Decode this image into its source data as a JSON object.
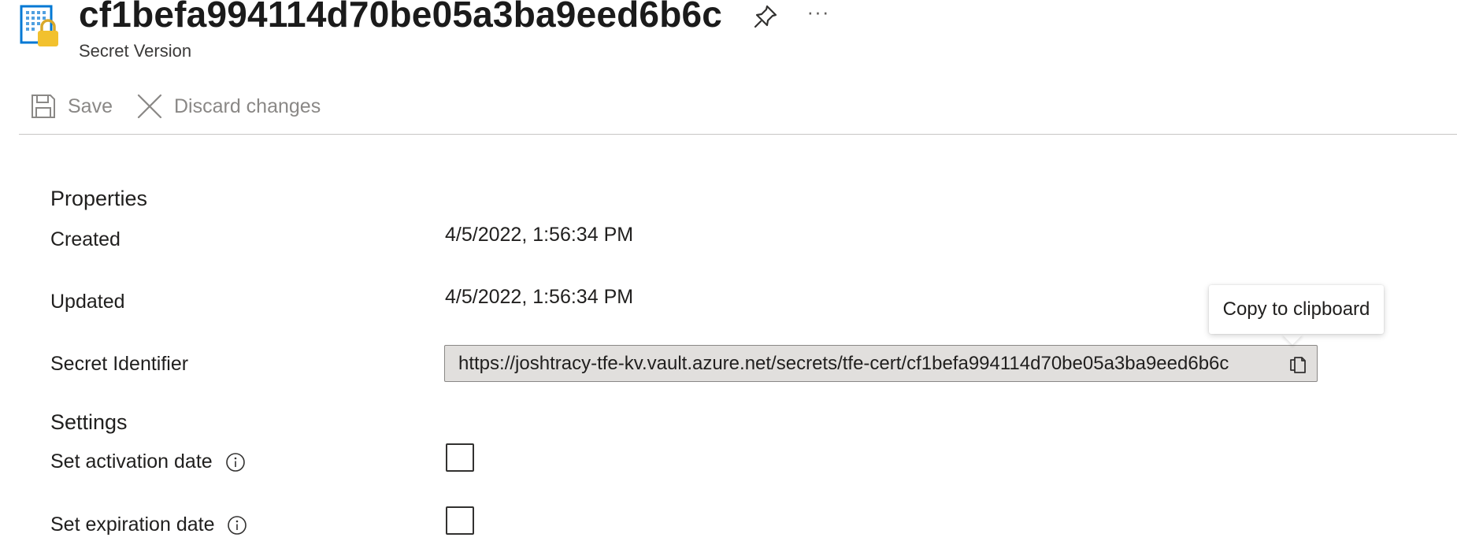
{
  "header": {
    "title": "cf1befa994114d70be05a3ba9eed6b6c",
    "subtitle": "Secret Version",
    "more_label": "···"
  },
  "toolbar": {
    "save_label": "Save",
    "discard_label": "Discard changes"
  },
  "properties": {
    "section_title": "Properties",
    "created_label": "Created",
    "created_value": "4/5/2022, 1:56:34 PM",
    "updated_label": "Updated",
    "updated_value": "4/5/2022, 1:56:34 PM",
    "identifier_label": "Secret Identifier",
    "identifier_value": "https://joshtracy-tfe-kv.vault.azure.net/secrets/tfe-cert/cf1befa994114d70be05a3ba9eed6b6c"
  },
  "tooltip": {
    "text": "Copy to clipboard"
  },
  "settings": {
    "section_title": "Settings",
    "activation_label": "Set activation date",
    "activation_checked": false,
    "expiration_label": "Set expiration date",
    "expiration_checked": false
  },
  "colors": {
    "icon_blue": "#0078d4",
    "lock_yellow": "#f2c12e",
    "disabled_text": "#8a8886"
  }
}
